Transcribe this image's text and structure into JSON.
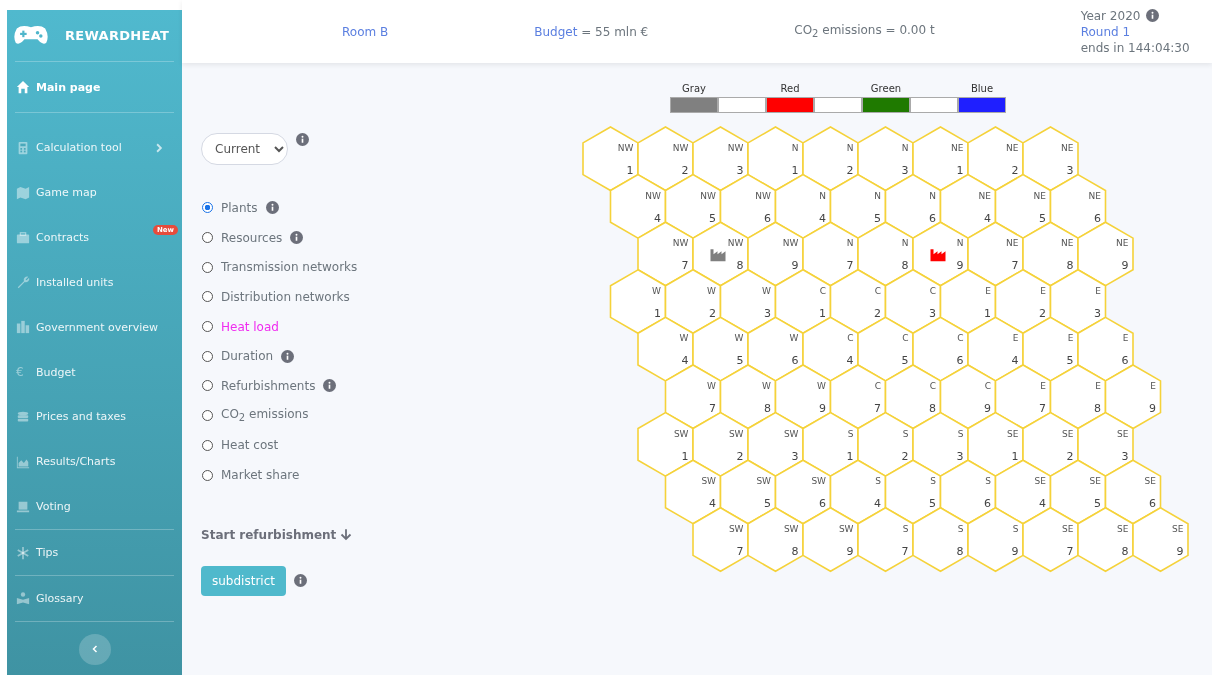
{
  "app": {
    "name": "REWARDHEAT"
  },
  "sidebar": {
    "items": [
      {
        "label": "Main page",
        "selected": true,
        "divider_after": true
      },
      {
        "label": "Calculation tool",
        "selected": false,
        "submenu": true
      },
      {
        "label": "Game map",
        "selected": false
      },
      {
        "label": "Contracts",
        "selected": false,
        "badge": "New"
      },
      {
        "label": "Installed units",
        "selected": false
      },
      {
        "label": "Government overview",
        "selected": false
      },
      {
        "label": "Budget",
        "glyph": "€",
        "selected": false
      },
      {
        "label": "Prices and taxes",
        "selected": false
      },
      {
        "label": "Results/Charts",
        "selected": false
      },
      {
        "label": "Voting",
        "selected": false,
        "divider_after": true
      },
      {
        "label": "Tips",
        "selected": false,
        "divider_after": true
      },
      {
        "label": "Glossary",
        "selected": false,
        "divider_after": true
      }
    ]
  },
  "header": {
    "room": "Room B",
    "budget_link": "Budget",
    "budget_value": " = 55 mln €",
    "emissions": "CO$_{2}$ emissions = 0.00 t",
    "year": "Year 2020",
    "round": "Round 1",
    "countdown": "ends in 144:04:30"
  },
  "controls": {
    "view": "Current",
    "layers": [
      {
        "label": "Plants",
        "selected": true,
        "info": true,
        "highlighted": false
      },
      {
        "label": "Resources",
        "selected": false,
        "info": true,
        "highlighted": false
      },
      {
        "label": "Transmission networks",
        "selected": false,
        "info": false,
        "highlighted": false
      },
      {
        "label": "Distribution networks",
        "selected": false,
        "info": false,
        "highlighted": false
      },
      {
        "label": "Heat load",
        "selected": false,
        "info": false,
        "highlighted": true
      },
      {
        "label": "Duration",
        "selected": false,
        "info": true,
        "highlighted": false
      },
      {
        "label": "Refurbishments",
        "selected": false,
        "info": true,
        "highlighted": false
      },
      {
        "label": "CO$_{2}$ emissions",
        "selected": false,
        "info": false,
        "highlighted": false
      },
      {
        "label": "Heat cost",
        "selected": false,
        "info": false,
        "highlighted": false
      },
      {
        "label": "Market share",
        "selected": false,
        "info": false,
        "highlighted": false
      }
    ],
    "refurbishment": "Start refurbishment",
    "subdistrict_button": "subdistrict"
  },
  "legend": [
    {
      "label": "Gray",
      "color": "#808080"
    },
    {
      "label": "Red",
      "color": "#ff0000"
    },
    {
      "label": "Green",
      "color": "#1f7a00"
    },
    {
      "label": "Blue",
      "color": "#1f1fff"
    }
  ],
  "map": {
    "rows": [
      [
        {
          "region": "NW",
          "number": "1"
        },
        {
          "region": "NW",
          "number": "2"
        },
        {
          "region": "NW",
          "number": "3"
        },
        {
          "region": "N",
          "number": "1"
        },
        {
          "region": "N",
          "number": "2"
        },
        {
          "region": "N",
          "number": "3"
        },
        {
          "region": "NE",
          "number": "1"
        },
        {
          "region": "NE",
          "number": "2"
        },
        {
          "region": "NE",
          "number": "3"
        }
      ],
      [
        {
          "region": "NW",
          "number": "4"
        },
        {
          "region": "NW",
          "number": "5"
        },
        {
          "region": "NW",
          "number": "6"
        },
        {
          "region": "N",
          "number": "4"
        },
        {
          "region": "N",
          "number": "5"
        },
        {
          "region": "N",
          "number": "6"
        },
        {
          "region": "NE",
          "number": "4"
        },
        {
          "region": "NE",
          "number": "5"
        },
        {
          "region": "NE",
          "number": "6"
        }
      ],
      [
        {
          "region": "NW",
          "number": "7"
        },
        {
          "region": "NW",
          "number": "8",
          "color": "#7f7f7f"
        },
        {
          "region": "NW",
          "number": "9"
        },
        {
          "region": "N",
          "number": "7"
        },
        {
          "region": "N",
          "number": "8"
        },
        {
          "region": "N",
          "number": "9",
          "color": "#ff0000"
        },
        {
          "region": "NE",
          "number": "7"
        },
        {
          "region": "NE",
          "number": "8"
        },
        {
          "region": "NE",
          "number": "9"
        }
      ],
      [
        {
          "region": "W",
          "number": "1"
        },
        {
          "region": "W",
          "number": "2"
        },
        {
          "region": "W",
          "number": "3"
        },
        {
          "region": "C",
          "number": "1"
        },
        {
          "region": "C",
          "number": "2"
        },
        {
          "region": "C",
          "number": "3"
        },
        {
          "region": "E",
          "number": "1"
        },
        {
          "region": "E",
          "number": "2"
        },
        {
          "region": "E",
          "number": "3"
        }
      ],
      [
        {
          "region": "W",
          "number": "4"
        },
        {
          "region": "W",
          "number": "5"
        },
        {
          "region": "W",
          "number": "6"
        },
        {
          "region": "C",
          "number": "4"
        },
        {
          "region": "C",
          "number": "5"
        },
        {
          "region": "C",
          "number": "6"
        },
        {
          "region": "E",
          "number": "4"
        },
        {
          "region": "E",
          "number": "5"
        },
        {
          "region": "E",
          "number": "6"
        }
      ],
      [
        {
          "region": "W",
          "number": "7"
        },
        {
          "region": "W",
          "number": "8"
        },
        {
          "region": "W",
          "number": "9"
        },
        {
          "region": "C",
          "number": "7"
        },
        {
          "region": "C",
          "number": "8"
        },
        {
          "region": "C",
          "number": "9"
        },
        {
          "region": "E",
          "number": "7"
        },
        {
          "region": "E",
          "number": "8"
        },
        {
          "region": "E",
          "number": "9"
        }
      ],
      [
        {
          "region": "SW",
          "number": "1"
        },
        {
          "region": "SW",
          "number": "2"
        },
        {
          "region": "SW",
          "number": "3"
        },
        {
          "region": "S",
          "number": "1"
        },
        {
          "region": "S",
          "number": "2"
        },
        {
          "region": "S",
          "number": "3"
        },
        {
          "region": "SE",
          "number": "1"
        },
        {
          "region": "SE",
          "number": "2"
        },
        {
          "region": "SE",
          "number": "3"
        }
      ],
      [
        {
          "region": "SW",
          "number": "4"
        },
        {
          "region": "SW",
          "number": "5"
        },
        {
          "region": "SW",
          "number": "6"
        },
        {
          "region": "S",
          "number": "4"
        },
        {
          "region": "S",
          "number": "5"
        },
        {
          "region": "S",
          "number": "6"
        },
        {
          "region": "SE",
          "number": "4"
        },
        {
          "region": "SE",
          "number": "5"
        },
        {
          "region": "SE",
          "number": "6"
        }
      ],
      [
        {
          "region": "SW",
          "number": "7"
        },
        {
          "region": "SW",
          "number": "8"
        },
        {
          "region": "SW",
          "number": "9"
        },
        {
          "region": "S",
          "number": "7"
        },
        {
          "region": "S",
          "number": "8"
        },
        {
          "region": "S",
          "number": "9"
        },
        {
          "region": "SE",
          "number": "7"
        },
        {
          "region": "SE",
          "number": "8"
        },
        {
          "region": "SE",
          "number": "9"
        }
      ]
    ]
  }
}
